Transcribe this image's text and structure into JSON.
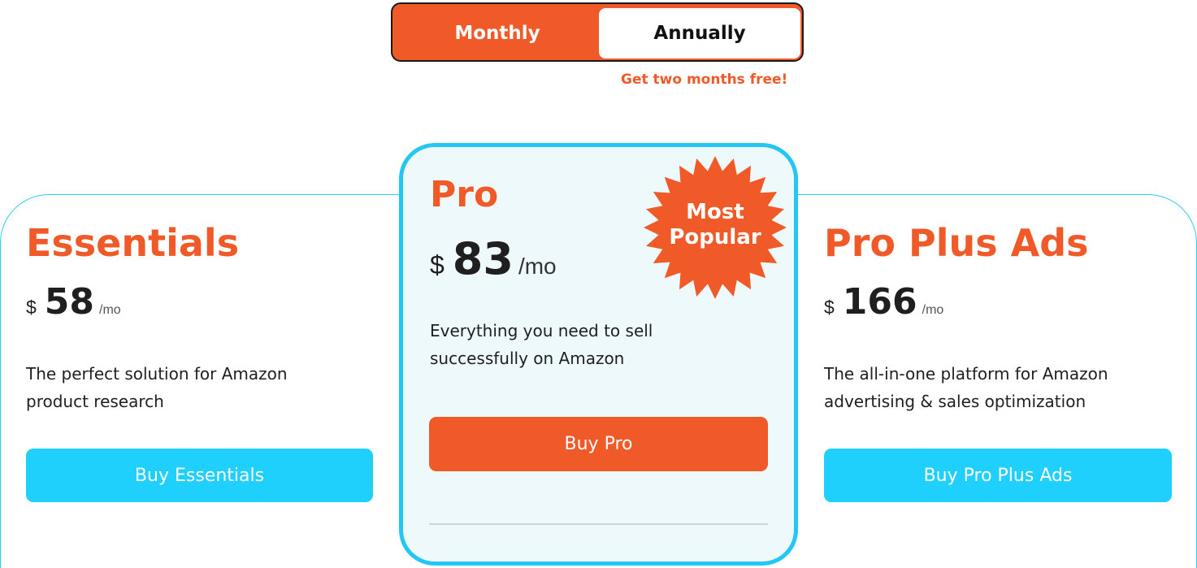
{
  "billing_toggle": {
    "monthly_label": "Monthly",
    "annually_label": "Annually",
    "selected": "Monthly",
    "promo_text": "Get two months free!"
  },
  "plans": [
    {
      "name": "Essentials",
      "currency": "$",
      "price": "58",
      "period": "/mo",
      "description_line1": "The perfect solution for Amazon",
      "description_line2": "product research",
      "button_label": "Buy Essentials"
    },
    {
      "name": "Pro",
      "currency": "$",
      "price": "83",
      "period": "/mo",
      "description_line1": "Everything you need to sell",
      "description_line2": "successfully on Amazon",
      "button_label": "Buy Pro",
      "badge_text": "Most\nPopular"
    },
    {
      "name": "Pro Plus Ads",
      "currency": "$",
      "price": "166",
      "period": "/mo",
      "description_line1": "The all-in-one platform for Amazon",
      "description_line2": "advertising & sales optimization",
      "button_label": "Buy Pro Plus Ads"
    }
  ],
  "colors": {
    "accent_orange": "#f05a28",
    "accent_blue": "#1fcffc",
    "featured_border": "#22c7f4",
    "featured_background": "#eef9fc"
  }
}
